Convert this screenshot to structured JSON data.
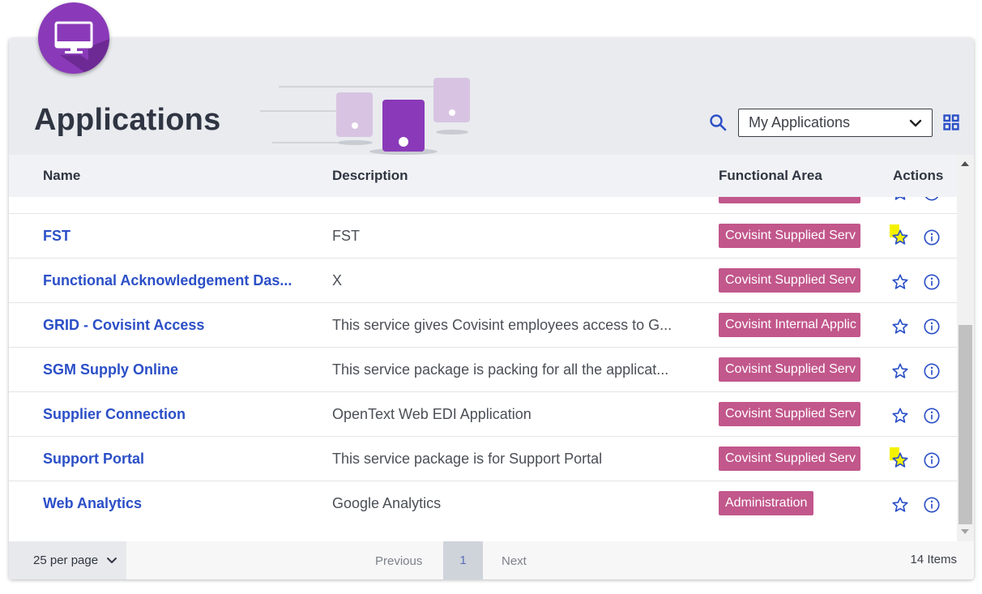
{
  "page": {
    "title": "Applications"
  },
  "filter": {
    "selected": "My Applications"
  },
  "icons": {
    "app": "desktop-monitor-icon",
    "search": "search-icon",
    "select": "chevron-down-icon",
    "view_toggle": "grid-view-icon",
    "favorite": "star-icon",
    "info": "info-icon"
  },
  "colors": {
    "accent": "#8a3ab9",
    "link": "#2b4fc7",
    "badge": "#c2578b",
    "favorite_highlight": "#f4f100"
  },
  "table": {
    "headers": {
      "name": "Name",
      "description": "Description",
      "area": "Functional Area",
      "actions": "Actions"
    },
    "rows": [
      {
        "name": "FST",
        "description": "FST",
        "area": "Covisint Supplied Serv",
        "favorite": true
      },
      {
        "name": "Functional Acknowledgement Das...",
        "description": "X",
        "area": "Covisint Supplied Serv",
        "favorite": false
      },
      {
        "name": "GRID - Covisint Access",
        "description": "This service gives Covisint employees access to G...",
        "area": "Covisint Internal Applic",
        "favorite": false
      },
      {
        "name": "SGM Supply Online",
        "description": "This service package is packing for all the applicat...",
        "area": "Covisint Supplied Serv",
        "favorite": false
      },
      {
        "name": "Supplier Connection",
        "description": "OpenText Web EDI Application",
        "area": "Covisint Supplied Serv",
        "favorite": false
      },
      {
        "name": "Support Portal",
        "description": "This service package is for Support Portal",
        "area": "Covisint Supplied Serv",
        "favorite": true
      },
      {
        "name": "Web Analytics",
        "description": "Google Analytics",
        "area": "Administration",
        "favorite": false
      }
    ]
  },
  "pagination": {
    "per_page": "25 per page",
    "previous": "Previous",
    "current": "1",
    "next": "Next",
    "total": "14 Items"
  }
}
